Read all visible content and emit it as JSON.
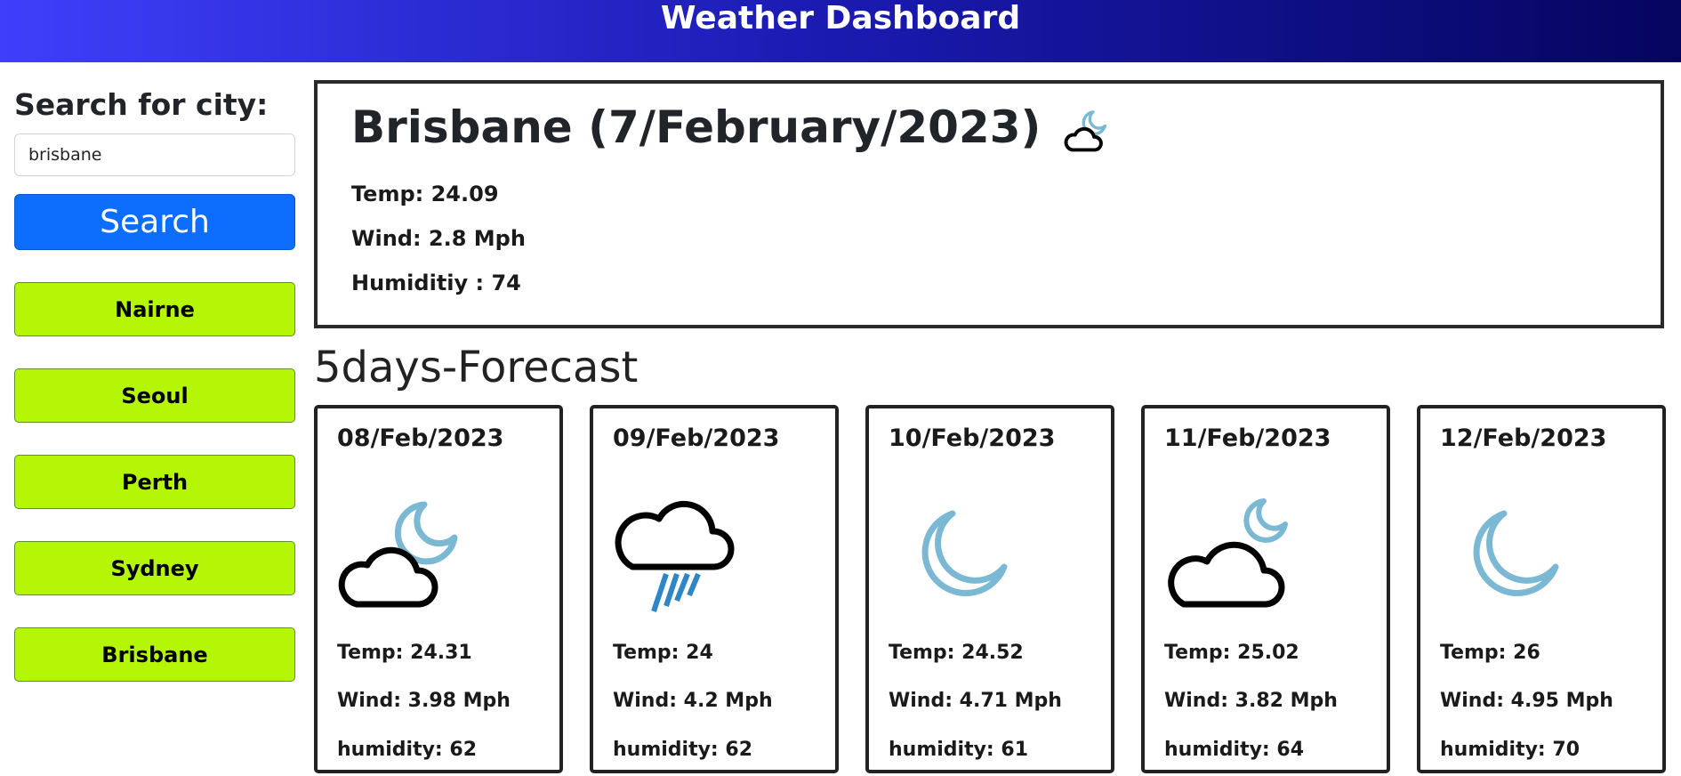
{
  "header": {
    "title": "Weather Dashboard"
  },
  "sidebar": {
    "search_title": "Search for city:",
    "search_value": "brisbane",
    "search_button": "Search",
    "history": [
      "Nairne",
      "Seoul",
      "Perth",
      "Sydney",
      "Brisbane"
    ]
  },
  "current": {
    "title": "Brisbane (7/February/2023)",
    "icon": "cloud-moon-icon",
    "temp": "Temp: 24.09",
    "wind": "Wind: 2.8 Mph",
    "humidity": "Humiditiy : 74"
  },
  "forecast": {
    "title": "5days-Forecast",
    "days": [
      {
        "date": "08/Feb/2023",
        "icon": "cloud-moon-icon",
        "temp": "Temp: 24.31",
        "wind": "Wind: 3.98 Mph",
        "humidity": "humidity: 62"
      },
      {
        "date": "09/Feb/2023",
        "icon": "cloud-rain-icon",
        "temp": "Temp: 24",
        "wind": "Wind: 4.2 Mph",
        "humidity": "humidity: 62"
      },
      {
        "date": "10/Feb/2023",
        "icon": "moon-icon",
        "temp": "Temp: 24.52",
        "wind": "Wind: 4.71 Mph",
        "humidity": "humidity: 61"
      },
      {
        "date": "11/Feb/2023",
        "icon": "cloud-moon-icon",
        "temp": "Temp: 25.02",
        "wind": "Wind: 3.82 Mph",
        "humidity": "humidity: 64"
      },
      {
        "date": "12/Feb/2023",
        "icon": "moon-icon",
        "temp": "Temp: 26",
        "wind": "Wind: 4.95 Mph",
        "humidity": "humidity: 70"
      }
    ]
  },
  "colors": {
    "header_gradient": [
      "#3f3ffb",
      "#05055f"
    ],
    "search_button": "#0d6efd",
    "history_button": "#b4f606",
    "moon": "#7ab8d4",
    "rain": "#2f86c6"
  }
}
